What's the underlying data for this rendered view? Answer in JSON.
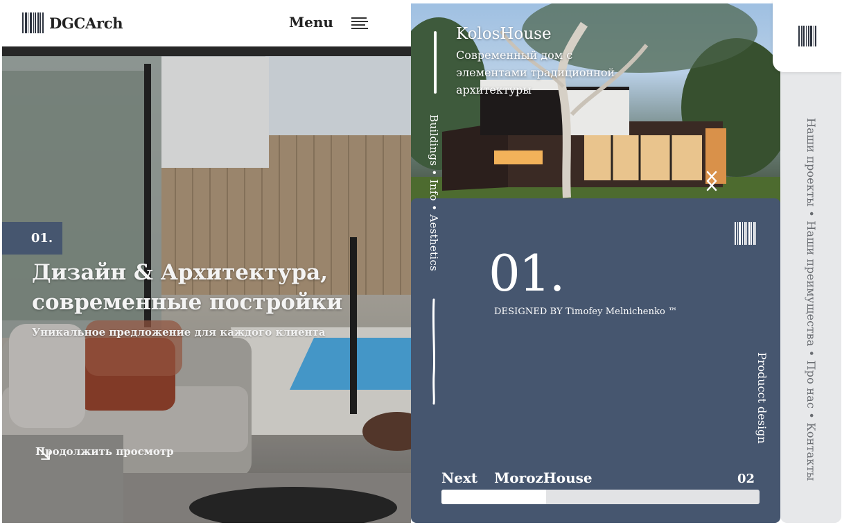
{
  "header": {
    "logo_text": "DGCArch",
    "menu_label": "Menu"
  },
  "hero": {
    "badge": "01.",
    "title_line1": "Дизайн & Архитектура,",
    "title_line2": "современные постройки",
    "subtitle": "Уникальное предложение для каждого клиента",
    "continue_label": "Продолжить просмотр"
  },
  "project": {
    "name": "KolosHouse",
    "description": "Современный дом с элементами традиционной архитектуры",
    "vertical_nav": "Buildings • Info • Aesthetics",
    "number": "01.",
    "designed_by": "DESIGNED BY Timofey Melnichenko  ™",
    "category": "Producct design",
    "next_label": "Next",
    "next_project": "MorozHouse",
    "next_number": "02",
    "progress": 0.33
  },
  "sidebar": {
    "nav_text": "Наши проекты • Наши преимущества • Про нас • Контакты"
  },
  "colors": {
    "panel": "#46566f",
    "rail": "#e7e8ea"
  },
  "icons": {
    "logo": "barcode-icon",
    "menu": "hamburger-icon",
    "continue": "arrow-down-right-icon",
    "prev": "chevron-left-icon",
    "next": "chevron-right-icon"
  }
}
